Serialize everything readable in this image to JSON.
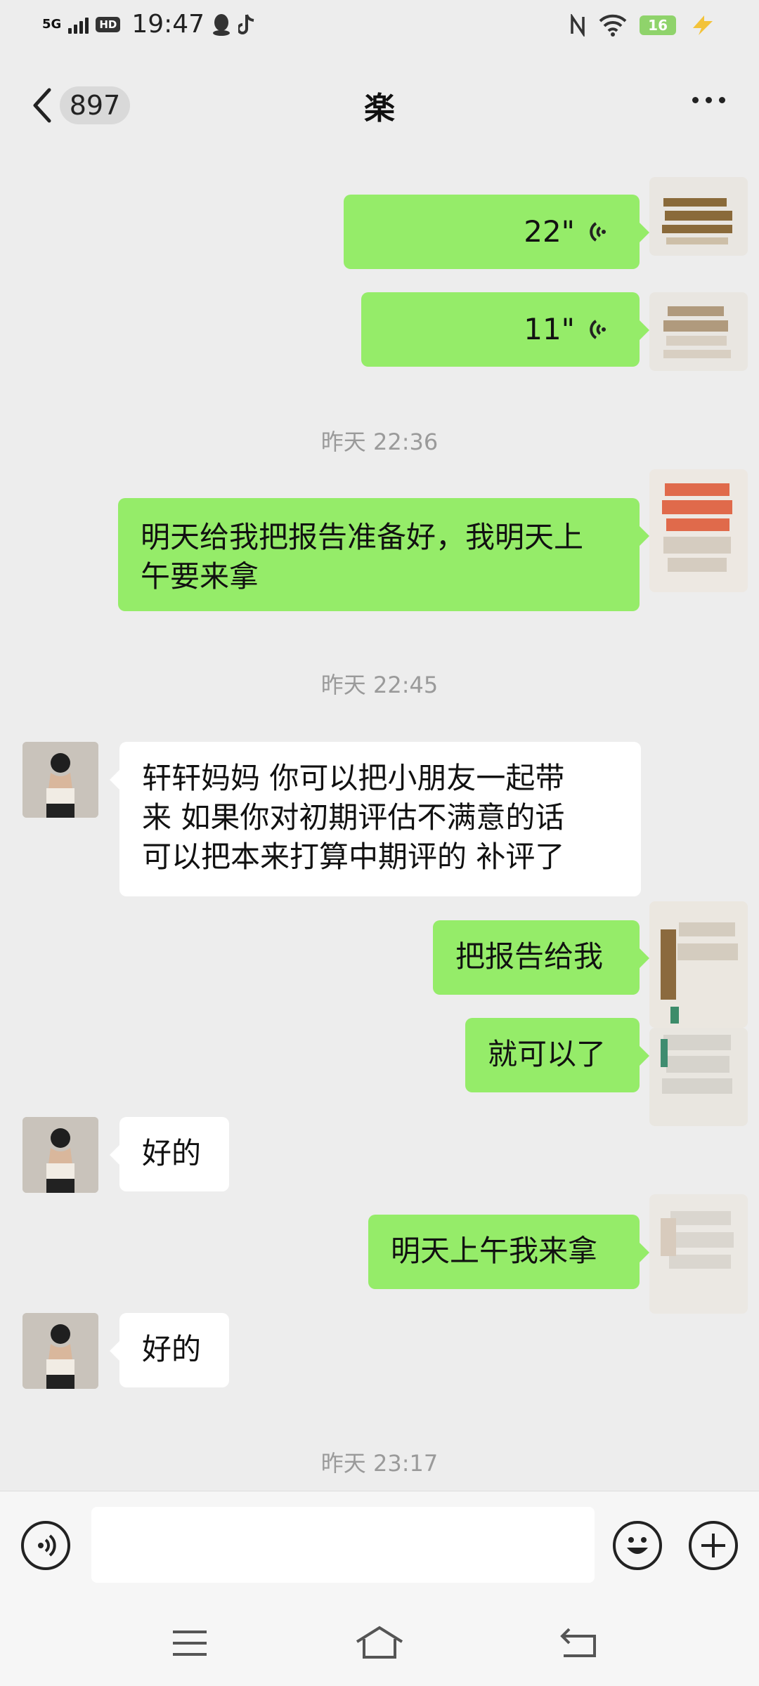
{
  "status_bar": {
    "network": "5G",
    "hd": "HD",
    "time": "19:47",
    "battery": "16"
  },
  "header": {
    "back_count": "897",
    "title": "楽"
  },
  "messages": {
    "voice1": {
      "duration": "22\""
    },
    "voice2": {
      "duration": "11\""
    },
    "ts1": "昨天 22:36",
    "m1": {
      "line1": "明天给我把报告准备好，我明天上",
      "line2": "午要来拿"
    },
    "ts2": "昨天 22:45",
    "m2": {
      "line1": "轩轩妈妈 你可以把小朋友一起带",
      "line2": "来 如果你对初期评估不满意的话",
      "line3": "可以把本来打算中期评的 补评了"
    },
    "m3": "把报告给我",
    "m4": "就可以了",
    "m5": "好的",
    "m6": "明天上午我来拿",
    "m7": "好的",
    "ts3": "昨天 23:17"
  },
  "input": {
    "placeholder": ""
  },
  "icons": {
    "back": "chevron-left-icon",
    "more": "more-icon",
    "voice": "voice-icon",
    "emoji": "emoji-icon",
    "plus": "plus-icon",
    "nav_menu": "menu-icon",
    "nav_home": "home-icon",
    "nav_back": "back-icon"
  },
  "colors": {
    "outgoing_bubble": "#95ec69",
    "incoming_bubble": "#ffffff",
    "background": "#ededed"
  }
}
